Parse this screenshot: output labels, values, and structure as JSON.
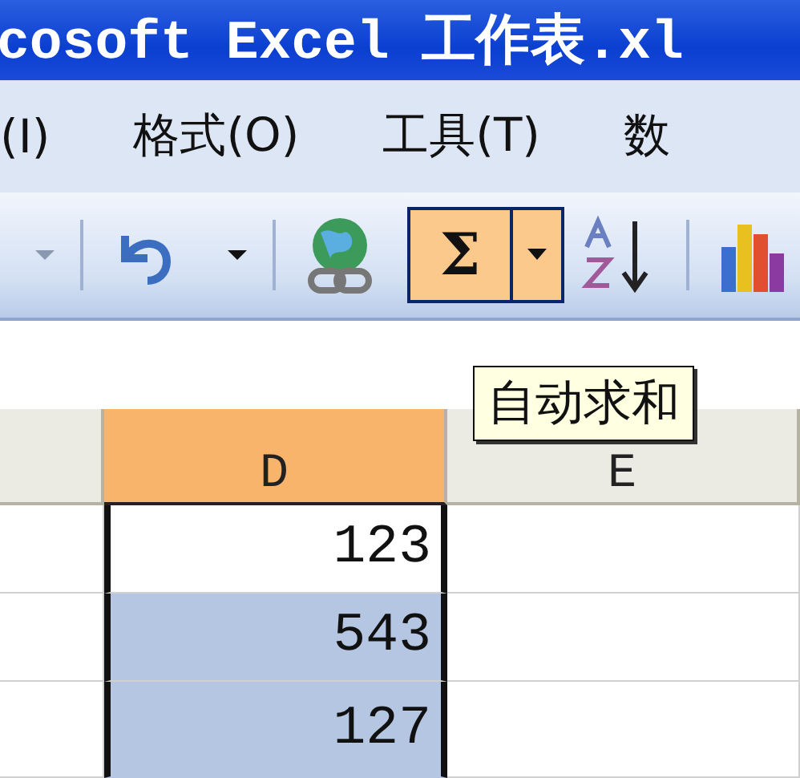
{
  "window": {
    "title": "cosoft Excel 工作表.xl"
  },
  "menu": [
    {
      "label": "(I)"
    },
    {
      "label": "格式(O)"
    },
    {
      "label": "工具(T)"
    },
    {
      "label": "数"
    }
  ],
  "toolbar": {
    "autosum": {
      "label": "Σ",
      "hovered": true
    }
  },
  "tooltip": "自动求和",
  "columns": [
    {
      "label": "D",
      "selected": true
    },
    {
      "label": "E",
      "selected": false
    }
  ],
  "cells": [
    {
      "value": "123",
      "active": true
    },
    {
      "value": "543",
      "active": false
    },
    {
      "value": "127",
      "active": false
    }
  ]
}
